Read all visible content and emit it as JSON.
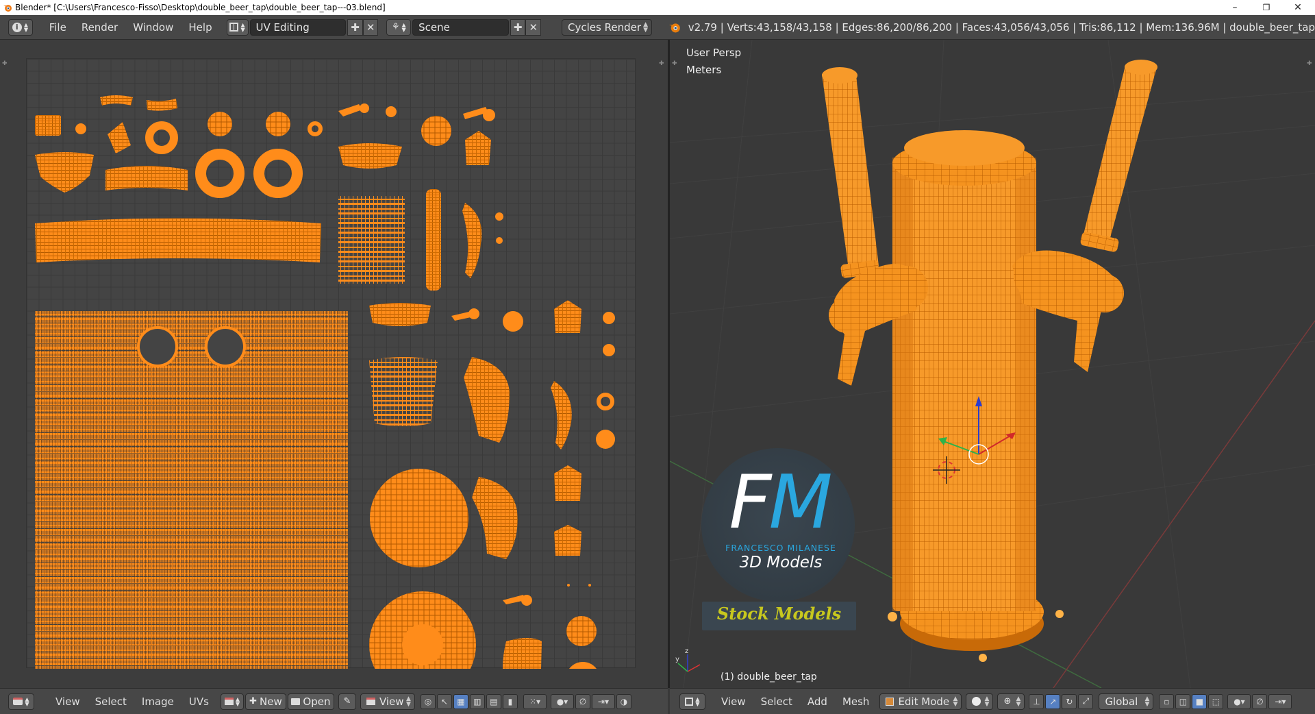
{
  "window": {
    "title": "Blender* [C:\\Users\\Francesco-Fisso\\Desktop\\double_beer_tap\\double_beer_tap---03.blend]",
    "minimize": "–",
    "maximize": "❐",
    "close": "✕"
  },
  "info_header": {
    "menus": [
      "File",
      "Render",
      "Window",
      "Help"
    ],
    "layout": "UV Editing",
    "scene": "Scene",
    "render_engine": "Cycles Render",
    "stats": "v2.79 | Verts:43,158/43,158 | Edges:86,200/86,200 | Faces:43,056/43,056 | Tris:86,112 | Mem:136.96M | double_beer_tap"
  },
  "viewport": {
    "view_name": "User Persp",
    "units": "Meters",
    "object_label": "(1) double_beer_tap"
  },
  "watermark": {
    "logo_letters": "FM",
    "author": "FRANCESCO MILANESE",
    "subtitle": "3D Models",
    "banner": "Stock Models"
  },
  "uv_header": {
    "menus": [
      "View",
      "Select",
      "Image",
      "UVs"
    ],
    "new_label": "New",
    "open_label": "Open",
    "view_label": "View"
  },
  "view3d_header": {
    "menus": [
      "View",
      "Select",
      "Add",
      "Mesh"
    ],
    "mode": "Edit Mode",
    "orientation": "Global"
  },
  "colors": {
    "mesh": "#ff8c1a",
    "mesh_dark": "#c86400",
    "accent": "#5680c2",
    "logo_blue": "#2aa7df",
    "banner_yellow": "#c8c81e"
  }
}
